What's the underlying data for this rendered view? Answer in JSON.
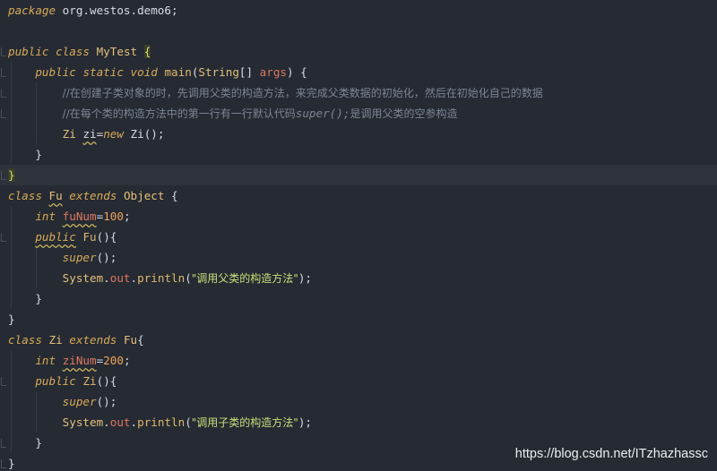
{
  "code": {
    "line1": {
      "kw": "package",
      "rest": " org.westos.demo6;"
    },
    "line3": {
      "kw1": "public",
      "kw2": "class",
      "name": "MyTest",
      "brace": "{"
    },
    "line4": {
      "kw1": "public",
      "kw2": "static",
      "kw3": "void",
      "method": "main",
      "paren_open": "(",
      "type": "String",
      "arr": "[] ",
      "param": "args",
      "tail": ") {"
    },
    "line5": {
      "comment": "//在创建子类对象的时，先调用父类的构造方法，来完成父类数据的初始化，然后在初始化自己的数据"
    },
    "line6": {
      "comment_a": "//在每个类的构造方法中的第一行有一行默认代码",
      "comment_b": "super();",
      "comment_c": "是调用父类的空参构造"
    },
    "line7": {
      "type": "Zi",
      "var": "zi",
      "eq": "=",
      "kw": "new",
      "ctor": " Zi();"
    },
    "line8": {
      "brace": "}"
    },
    "line9": {
      "brace": "}"
    },
    "line10": {
      "kw1": "class",
      "name": "Fu",
      "kw2": "extends",
      "parent": "Object",
      "brace": " {"
    },
    "line11": {
      "kw": "int",
      "field": "fuNum",
      "eq": "=",
      "num": "100",
      "semi": ";"
    },
    "line12": {
      "kw": "public",
      "name": "Fu",
      "tail": "(){"
    },
    "line13": {
      "kw": "super",
      "tail": "();"
    },
    "line14": {
      "obj": "System",
      "dot1": ".",
      "out": "out",
      "dot2": ".",
      "method": "println",
      "open": "(",
      "str": "\"调用父类的构造方法\"",
      "close": ");"
    },
    "line15": {
      "brace": "}"
    },
    "line16": {
      "brace": "}"
    },
    "line17": {
      "kw1": "class",
      "name": "Zi",
      "kw2": "extends",
      "parent": "Fu",
      "brace": "{"
    },
    "line18": {
      "kw": "int",
      "field": "ziNum",
      "eq": "=",
      "num": "200",
      "semi": ";"
    },
    "line19": {
      "kw": "public",
      "name": "Zi",
      "tail": "(){"
    },
    "line20": {
      "kw": "super",
      "tail": "();"
    },
    "line21": {
      "obj": "System",
      "dot1": ".",
      "out": "out",
      "dot2": ".",
      "method": "println",
      "open": "(",
      "str": "\"调用子类的构造方法\"",
      "close": ");"
    },
    "line22": {
      "brace": "}"
    },
    "line23": {
      "brace": "}"
    }
  },
  "watermark": "https://blog.csdn.net/ITzhazhassc"
}
